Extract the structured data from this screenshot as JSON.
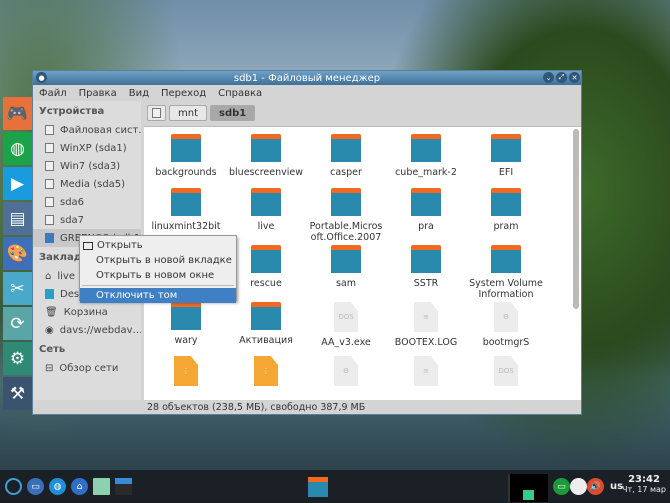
{
  "window": {
    "title": "sdb1 - Файловый менеджер"
  },
  "menu": [
    "Файл",
    "Правка",
    "Вид",
    "Переход",
    "Справка"
  ],
  "sidebar": {
    "devices_header": "Устройства",
    "devices": [
      "Файловая сист…",
      "WinXP (sda1)",
      "Win7 (sda3)",
      "Media (sda5)",
      "sda6",
      "sda7",
      "GREENOS (sdb1)"
    ],
    "bookmarks_header": "Закладки",
    "bookmarks": [
      "live",
      "Desktop",
      "Корзина",
      "davs://webdav…"
    ],
    "network_header": "Сеть",
    "network": [
      "Обзор сети"
    ]
  },
  "path": [
    "mnt",
    "sdb1"
  ],
  "files": [
    {
      "name": "backgrounds",
      "type": "folder"
    },
    {
      "name": "bluescreenview",
      "type": "folder"
    },
    {
      "name": "casper",
      "type": "folder"
    },
    {
      "name": "cube_mark-2",
      "type": "folder"
    },
    {
      "name": "EFI",
      "type": "folder"
    },
    {
      "name": "linuxmint32bit",
      "type": "folder"
    },
    {
      "name": "live",
      "type": "folder"
    },
    {
      "name": "Portable.Microsoft.Office.2007",
      "type": "folder"
    },
    {
      "name": "pra",
      "type": "folder"
    },
    {
      "name": "pram",
      "type": "folder"
    },
    {
      "name": "",
      "type": "folder"
    },
    {
      "name": "rescue",
      "type": "folder"
    },
    {
      "name": "sam",
      "type": "folder"
    },
    {
      "name": "SSTR",
      "type": "folder"
    },
    {
      "name": "System Volume Information",
      "type": "folder"
    },
    {
      "name": "wary",
      "type": "folder"
    },
    {
      "name": "Активация",
      "type": "folder"
    },
    {
      "name": "AA_v3.exe",
      "type": "dos"
    },
    {
      "name": "BOOTEX.LOG",
      "type": "text"
    },
    {
      "name": "bootmgrS",
      "type": "gear"
    },
    {
      "name": "",
      "type": "zip"
    },
    {
      "name": "",
      "type": "zip"
    },
    {
      "name": "",
      "type": "gear"
    },
    {
      "name": "",
      "type": "text"
    },
    {
      "name": "",
      "type": "dos"
    }
  ],
  "status": "28 объектов (238,5 МБ), свободно 387,9 МБ",
  "context_menu": [
    "Открыть",
    "Открыть в новой вкладке",
    "Открыть в новом окне",
    "Отключить том"
  ],
  "taskbar": {
    "layout": "us",
    "time": "23:42",
    "date": "Чт, 17 мар"
  },
  "colors": {
    "folder": "#2a8aae",
    "folder_tab": "#f26a22",
    "highlight": "#3f7fc3"
  }
}
